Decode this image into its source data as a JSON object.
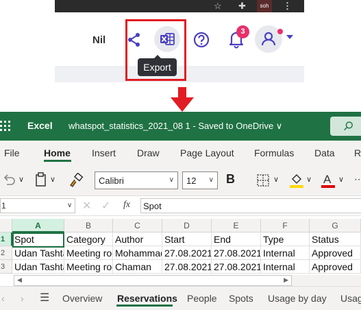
{
  "app_header": {
    "user_name": "Nil",
    "browser_profile_label": "soh",
    "notification_count": "3",
    "export_tooltip": "Export"
  },
  "excel": {
    "app_name": "Excel",
    "document_title": "whatspot_statistics_2021_08 1  -  Saved to OneDrive ∨",
    "ribbon_tabs": [
      "File",
      "Home",
      "Insert",
      "Draw",
      "Page Layout",
      "Formulas",
      "Data",
      "R"
    ],
    "active_tab": "Home",
    "font_name": "Calibri",
    "font_size": "12",
    "bold_label": "B",
    "name_box": "1",
    "fx_label": "fx",
    "formula_value": "Spot",
    "columns": [
      "A",
      "B",
      "C",
      "D",
      "E",
      "F",
      "G"
    ],
    "rows": [
      {
        "num": "1",
        "cells": [
          "Spot",
          "Category",
          "Author",
          "Start",
          "End",
          "Type",
          "Status"
        ]
      },
      {
        "num": "2",
        "cells": [
          "Udan Tashtari",
          "Meeting room",
          "Mohammad",
          "27.08.2021",
          "27.08.2021",
          "Internal",
          "Approved"
        ]
      },
      {
        "num": "3",
        "cells": [
          "Udan Tashtari",
          "Meeting room",
          "Chaman",
          "27.08.2021",
          "27.08.2021",
          "Internal",
          "Approved"
        ]
      }
    ],
    "sheet_tabs": [
      "Overview",
      "Reservations",
      "People",
      "Spots",
      "Usage by day",
      "Usag"
    ],
    "active_sheet": "Reservations",
    "colors": {
      "excel_green": "#1f7244",
      "highlight_red": "#e21c24",
      "badge_pink": "#e8306b",
      "accent_purple": "#4a3fc3"
    }
  }
}
